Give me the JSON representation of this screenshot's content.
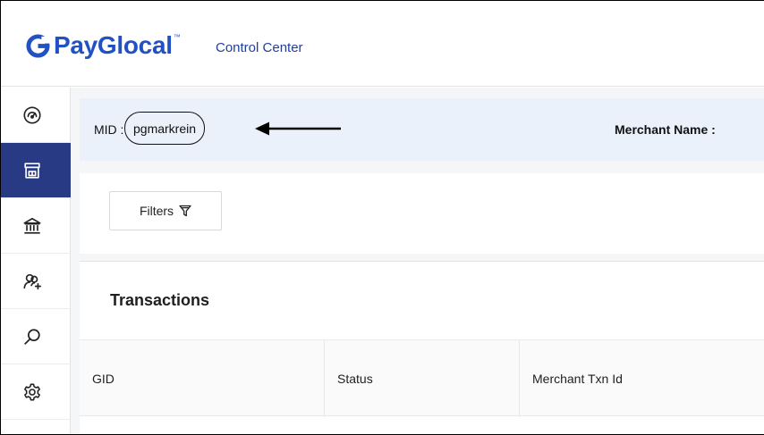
{
  "header": {
    "logo_text": "PayGlocal",
    "logo_tm": "™",
    "product_name": "Control Center",
    "brand_color": "#2151c4"
  },
  "sidebar": {
    "items": [
      {
        "icon": "dashboard-icon",
        "active": false
      },
      {
        "icon": "store-icon",
        "active": true
      },
      {
        "icon": "bank-icon",
        "active": false
      },
      {
        "icon": "add-user-icon",
        "active": false
      },
      {
        "icon": "search-icon",
        "active": false
      },
      {
        "icon": "gear-icon",
        "active": false
      }
    ],
    "active_color": "#283a83"
  },
  "merchant_bar": {
    "mid_label": "MID :",
    "mid_value": "pgmarkrein",
    "merchant_name_label": "Merchant Name :"
  },
  "filters": {
    "button_label": "Filters",
    "icon": "filter-icon"
  },
  "transactions": {
    "title": "Transactions",
    "columns": [
      "GID",
      "Status",
      "Merchant Txn Id"
    ]
  }
}
